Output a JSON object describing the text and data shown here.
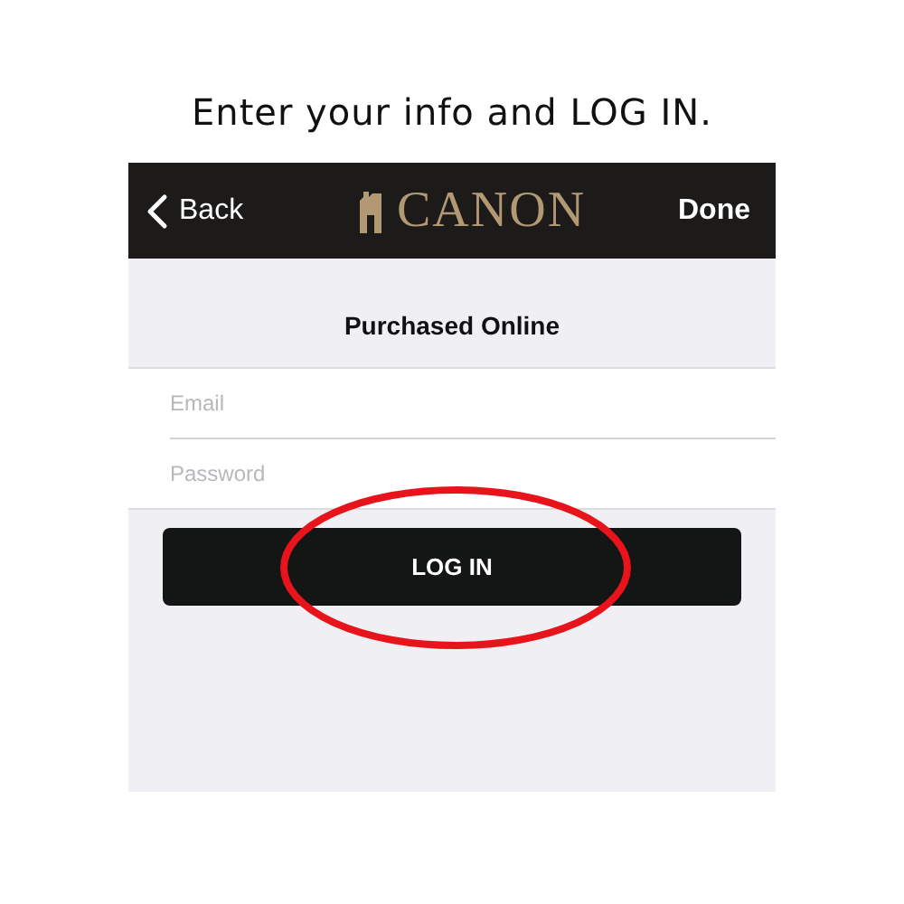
{
  "caption": "Enter your info and LOG IN.",
  "nav_bar": {
    "back": "Back",
    "logo": "CANON",
    "done": "Done"
  },
  "section_title": "Purchased Online",
  "fields": [
    {
      "placeholder": "Email"
    },
    {
      "placeholder": "Password"
    }
  ],
  "login_button": {
    "label": "LOG IN",
    "highlighted": true
  }
}
